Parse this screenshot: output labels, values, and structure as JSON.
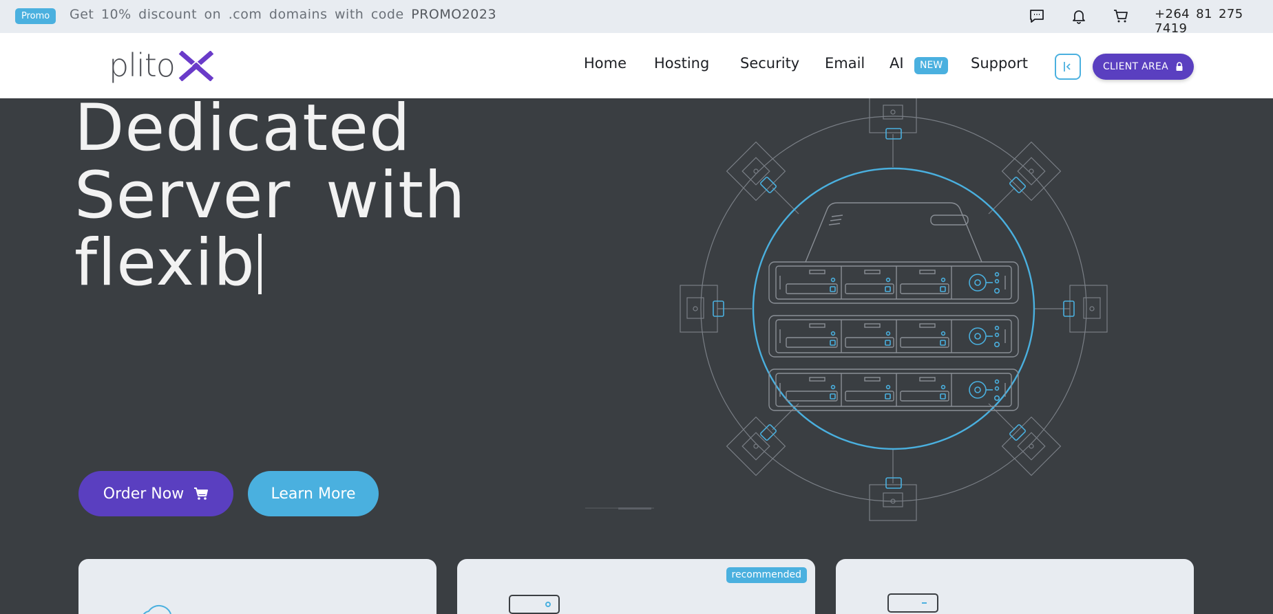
{
  "promo": {
    "badge": "Promo",
    "text": "Get 10% discount on .com domains with code",
    "code": "PROMO2023"
  },
  "topbar": {
    "icons": [
      "chat-icon",
      "bell-icon",
      "cart-icon"
    ],
    "phone": "+264 81 275 7419"
  },
  "nav": {
    "logo_text": "plito",
    "logo_mark": "X",
    "links": [
      "Home",
      "Hosting",
      "Security",
      "Email",
      "AI",
      "Support"
    ],
    "ai_badge": "NEW",
    "client_area": "CLIENT AREA"
  },
  "hero": {
    "line1": "Dedicated",
    "line2": "Server with",
    "line3": "flexib",
    "order_button": "Order Now",
    "learn_button": "Learn More"
  },
  "cards": {
    "recommended_badge": "recommended"
  },
  "colors": {
    "primary": "#5a3fc0",
    "accent": "#4ab0df",
    "hero_bg": "#3a3e42",
    "topbar_bg": "#e8ecf1"
  }
}
